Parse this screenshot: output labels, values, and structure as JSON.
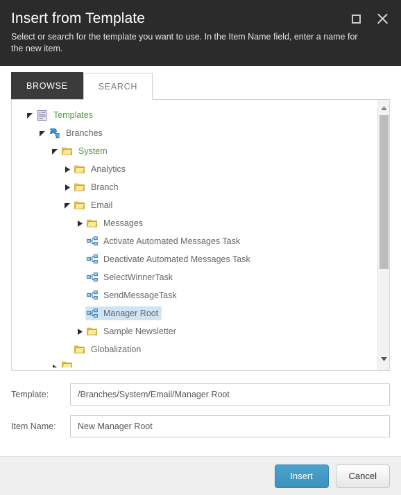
{
  "dialog": {
    "title": "Insert from Template",
    "subtitle": "Select or search for the template you want to use. In the Item Name field, enter a name for the new item.",
    "maximize_icon": "maximize-icon",
    "close_icon": "close-icon"
  },
  "tabs": [
    {
      "label": "BROWSE",
      "active": true
    },
    {
      "label": "SEARCH",
      "active": false
    }
  ],
  "tree": {
    "nodes": [
      {
        "label": "Templates",
        "indent": 0,
        "state": "expanded",
        "icon": "templates-root-icon",
        "green": true,
        "selected": false
      },
      {
        "label": "Branches",
        "indent": 1,
        "state": "expanded",
        "icon": "puzzle-icon",
        "green": false,
        "selected": false
      },
      {
        "label": "System",
        "indent": 2,
        "state": "expanded",
        "icon": "folder-icon",
        "green": true,
        "selected": false
      },
      {
        "label": "Analytics",
        "indent": 3,
        "state": "collapsed",
        "icon": "folder-icon",
        "green": false,
        "selected": false
      },
      {
        "label": "Branch",
        "indent": 3,
        "state": "collapsed",
        "icon": "folder-icon",
        "green": false,
        "selected": false
      },
      {
        "label": "Email",
        "indent": 3,
        "state": "expanded",
        "icon": "folder-icon",
        "green": false,
        "selected": false
      },
      {
        "label": "Messages",
        "indent": 4,
        "state": "collapsed",
        "icon": "folder-icon",
        "green": false,
        "selected": false
      },
      {
        "label": "Activate Automated Messages Task",
        "indent": 4,
        "state": "leaf",
        "icon": "template-icon",
        "green": false,
        "selected": false
      },
      {
        "label": "Deactivate Automated Messages Task",
        "indent": 4,
        "state": "leaf",
        "icon": "template-icon",
        "green": false,
        "selected": false
      },
      {
        "label": "SelectWinnerTask",
        "indent": 4,
        "state": "leaf",
        "icon": "template-icon",
        "green": false,
        "selected": false
      },
      {
        "label": "SendMessageTask",
        "indent": 4,
        "state": "leaf",
        "icon": "template-icon",
        "green": false,
        "selected": false
      },
      {
        "label": "Manager Root",
        "indent": 4,
        "state": "leaf",
        "icon": "template-icon",
        "green": false,
        "selected": true
      },
      {
        "label": "Sample Newsletter",
        "indent": 4,
        "state": "collapsed",
        "icon": "folder-icon",
        "green": false,
        "selected": false
      },
      {
        "label": "Globalization",
        "indent": 3,
        "state": "leaf",
        "icon": "folder-icon",
        "green": false,
        "selected": false
      }
    ],
    "scrollbar": {
      "up_arrow_icon": "scroll-up-icon",
      "down_arrow_icon": "scroll-down-icon"
    }
  },
  "form": {
    "template": {
      "label": "Template:",
      "value": "/Branches/System/Email/Manager Root",
      "placeholder": ""
    },
    "item_name": {
      "label": "Item Name:",
      "value": "New Manager Root",
      "placeholder": ""
    }
  },
  "footer": {
    "insert_label": "Insert",
    "cancel_label": "Cancel"
  },
  "colors": {
    "header_bg": "#2b2b2b",
    "tab_active_bg": "#3b3b3b",
    "selection_bg": "#cfe5f5",
    "green_label": "#4e9b3c",
    "primary_button": "#3c92bf",
    "footer_bg": "#efefef"
  }
}
